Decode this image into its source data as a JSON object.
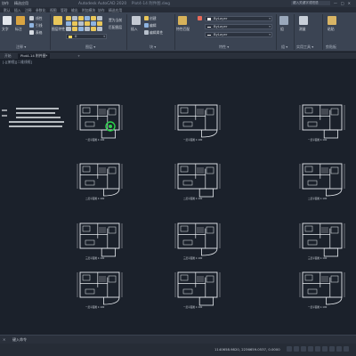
{
  "titlebar": {
    "left_items": [
      "协作",
      "精选应用"
    ],
    "title": "Autodesk AutoCAD 2020",
    "file": "Plot4-14 附件图.dwg",
    "search_placeholder": "键入关键字或短语",
    "window_buttons": [
      "—",
      "□",
      "✕"
    ]
  },
  "tabs": [
    "默认",
    "插入",
    "注释",
    "参数化",
    "视图",
    "管理",
    "输出",
    "附加模块",
    "协作",
    "精选应用"
  ],
  "ribbon": {
    "panels": [
      "注释 ▾",
      "图层 ▾",
      "块 ▾",
      "特性 ▾",
      "组 ▾",
      "实用工具 ▾",
      "剪贴板"
    ],
    "text_buttons": [
      "文字",
      "标注",
      "线性",
      "引线",
      "表格",
      "图层特性",
      "置为当前",
      "匹配图层",
      "插入",
      "创建",
      "编辑",
      "编辑属性",
      "特性匹配",
      "组",
      "测量",
      "粘贴"
    ],
    "layer_combo": "0",
    "bylayer_1": "ByLayer",
    "bylayer_2": "ByLayer",
    "bylayer_3": "ByLayer",
    "colors": {
      "ribbon_bg": "#3b4453",
      "canvas_bg": "#1b212b",
      "accent_green": "#2bd14b",
      "line_white": "#e8ecf0"
    }
  },
  "filetabs": [
    "开始",
    "Plot4-14 附件图*",
    "+"
  ],
  "canvas": {
    "viewport_label": "[-][俯视][二维线框]",
    "plan_captions": [
      "一层平面图 1:100",
      "二层平面图 1:100",
      "三层平面图 1:100"
    ]
  },
  "cmdline": {
    "close": "✕",
    "prompt": "键入命令"
  },
  "statusbar": {
    "coords": "1140658.9820, 2236659.0537, 0.0000",
    "model_tab": "模型"
  }
}
